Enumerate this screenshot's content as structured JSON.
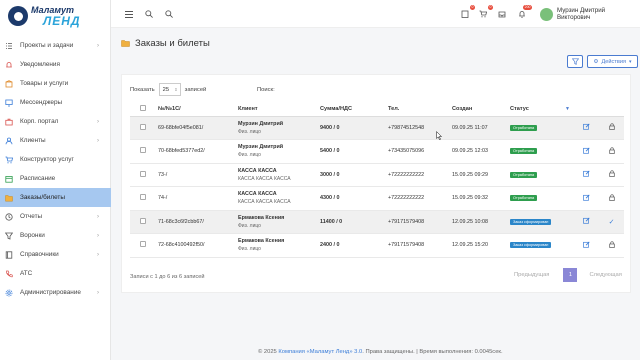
{
  "brand": {
    "line1": "Маламут",
    "line2": "ЛЕНД"
  },
  "sidebar": {
    "items": [
      {
        "label": "Проекты и задачи",
        "icon": "checklist-icon",
        "chevron": true
      },
      {
        "label": "Уведомления",
        "icon": "bell-icon",
        "chevron": false
      },
      {
        "label": "Товары и услуги",
        "icon": "box-icon",
        "chevron": false
      },
      {
        "label": "Мессенджеры",
        "icon": "monitor-icon",
        "chevron": false
      },
      {
        "label": "Корп. портал",
        "icon": "briefcase-icon",
        "chevron": true
      },
      {
        "label": "Клиенты",
        "icon": "user-icon",
        "chevron": true
      },
      {
        "label": "Конструктор услуг",
        "icon": "cart-icon",
        "chevron": false
      },
      {
        "label": "Расписание",
        "icon": "calendar-icon",
        "chevron": false
      },
      {
        "label": "Заказы/билеты",
        "icon": "folder-icon",
        "chevron": false,
        "active": true
      },
      {
        "label": "Отчеты",
        "icon": "clock-icon",
        "chevron": true
      },
      {
        "label": "Воронки",
        "icon": "funnel-icon",
        "chevron": true
      },
      {
        "label": "Справочники",
        "icon": "book-icon",
        "chevron": true
      },
      {
        "label": "АТС",
        "icon": "phone-icon",
        "chevron": false
      },
      {
        "label": "Администрирование",
        "icon": "gear-icon",
        "chevron": true
      }
    ]
  },
  "topbar": {
    "badges": [
      "0",
      "0",
      "",
      "200"
    ],
    "user_name": "Мурзин Дмитрий Викторович"
  },
  "page": {
    "title": "Заказы и билеты",
    "actions_label": "Действия"
  },
  "table_controls": {
    "show_label": "Показать",
    "page_size": "25",
    "records_label": "записей",
    "search_label": "Поиск:",
    "search_value": ""
  },
  "table": {
    "headers": [
      "№/№1С/",
      "Клиент",
      "Сумма/НДС",
      "Тел.",
      "Создан",
      "Статус"
    ],
    "rows": [
      {
        "num": "69-68bfe04f5e081/",
        "client": "Мурзин Дмитрий",
        "client_sub": "Физ. лицо",
        "sum": "9400 / 0",
        "phone": "+79874512548",
        "created": "09.09.25 11:07",
        "status": "Отработана",
        "status_color": "#2e9e4e",
        "action": "lock-icon",
        "highlight": true
      },
      {
        "num": "70-68bfed5377ed2/",
        "client": "Мурзин Дмитрий",
        "client_sub": "Физ. лицо",
        "sum": "5400 / 0",
        "phone": "+73435075096",
        "created": "09.09.25 12:03",
        "status": "Отработана",
        "status_color": "#2e9e4e",
        "action": "lock-icon",
        "highlight": false
      },
      {
        "num": "73-/",
        "client": "КАССА КАССА",
        "client_sub": "КАССА КАССА КАССА",
        "sum": "3000 / 0",
        "phone": "+72222222222",
        "created": "15.09.25 09:29",
        "status": "Отработана",
        "status_color": "#2e9e4e",
        "action": "lock-icon",
        "highlight": false
      },
      {
        "num": "74-/",
        "client": "КАССА КАССА",
        "client_sub": "КАССА КАССА КАССА",
        "sum": "4300 / 0",
        "phone": "+72222222222",
        "created": "15.09.25 09:32",
        "status": "Отработана",
        "status_color": "#2e9e4e",
        "action": "lock-icon",
        "highlight": false
      },
      {
        "num": "71-68c3c6f2cbb67/",
        "client": "Ермакова Ксения",
        "client_sub": "Физ. лицо",
        "sum": "11400 / 0",
        "phone": "+79171579408",
        "created": "12.09.25 10:08",
        "status": "Заказ сформирован",
        "status_color": "#2b86c9",
        "action": "check-icon",
        "highlight": true
      },
      {
        "num": "72-68c4100492f50/",
        "client": "Ермакова Ксения",
        "client_sub": "Физ. лицо",
        "sum": "2400 / 0",
        "phone": "+79171579408",
        "created": "12.09.25 15:20",
        "status": "Заказ сформирован",
        "status_color": "#2b86c9",
        "action": "lock-icon",
        "highlight": false
      }
    ]
  },
  "footer": {
    "info": "Записи с 1 до 6 из 6 записей",
    "prev": "Предыдущая",
    "page": "1",
    "next": "Следующая"
  },
  "copyright": {
    "prefix": "© 2025",
    "link": "Компания «Маламут Ленд» 3.0",
    "suffix": ". Права защищены. | Время выполнения: 0.0045сек."
  }
}
